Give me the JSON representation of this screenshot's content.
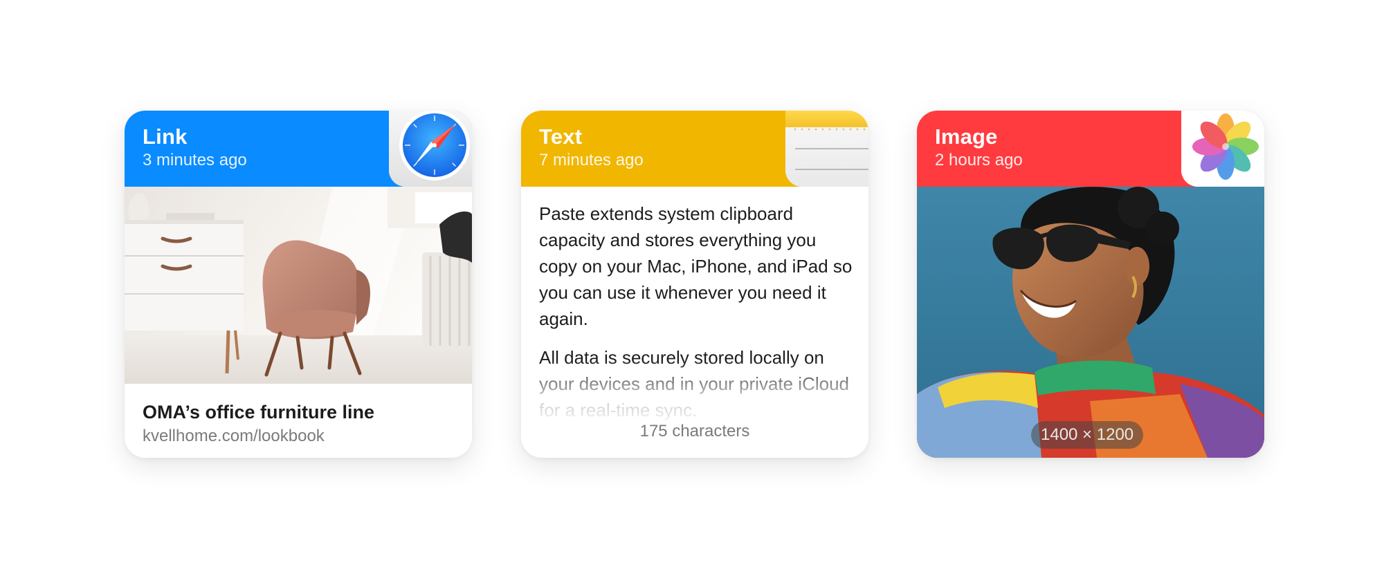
{
  "cards": {
    "link": {
      "title": "Link",
      "time": "3 minutes ago",
      "app_icon": "safari-icon",
      "header_color": "#0a8bff",
      "page_title": "OMA’s office furniture line",
      "url": "kvellhome.com/lookbook"
    },
    "text": {
      "title": "Text",
      "time": "7 minutes ago",
      "app_icon": "notes-icon",
      "header_color": "#f1b600",
      "paragraphs": [
        "Paste extends system clipboard capacity and stores everything you copy on your Mac, iPhone, and iPad so you can use it whenever you need it again.",
        "All data is securely stored locally on your devices and in your private iCloud for a real-time sync."
      ],
      "char_count": "175 characters"
    },
    "image": {
      "title": "Image",
      "time": "2 hours ago",
      "app_icon": "photos-icon",
      "header_color": "#ff3b3f",
      "dimensions": "1400 × 1200"
    }
  }
}
